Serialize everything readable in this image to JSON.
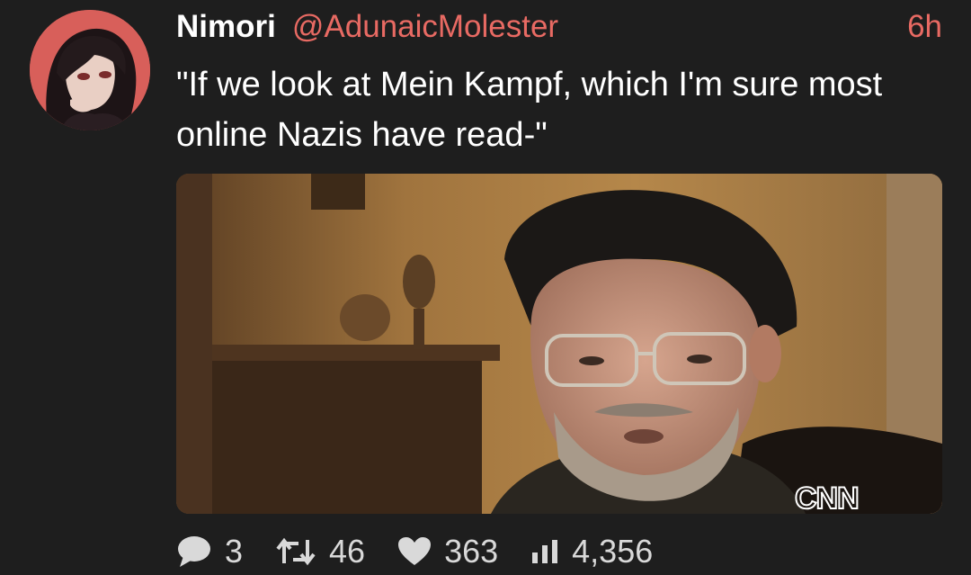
{
  "tweet": {
    "display_name": "Nimori",
    "handle": "@AdunaicMolester",
    "time": "6h",
    "text": "\"If we look at Mein Kampf, which I'm sure most online Nazis have read-\"",
    "media": {
      "watermark": "CNN"
    },
    "actions": {
      "replies": "3",
      "retweets": "46",
      "likes": "363",
      "views": "4,356"
    }
  },
  "colors": {
    "background": "#1e1e1e",
    "accent": "#e86a63",
    "text": "#ffffff",
    "muted": "#d9d9d9"
  },
  "icons": {
    "reply": "speech-bubble-icon",
    "retweet": "retweet-icon",
    "like": "heart-icon",
    "views": "bar-chart-icon"
  }
}
